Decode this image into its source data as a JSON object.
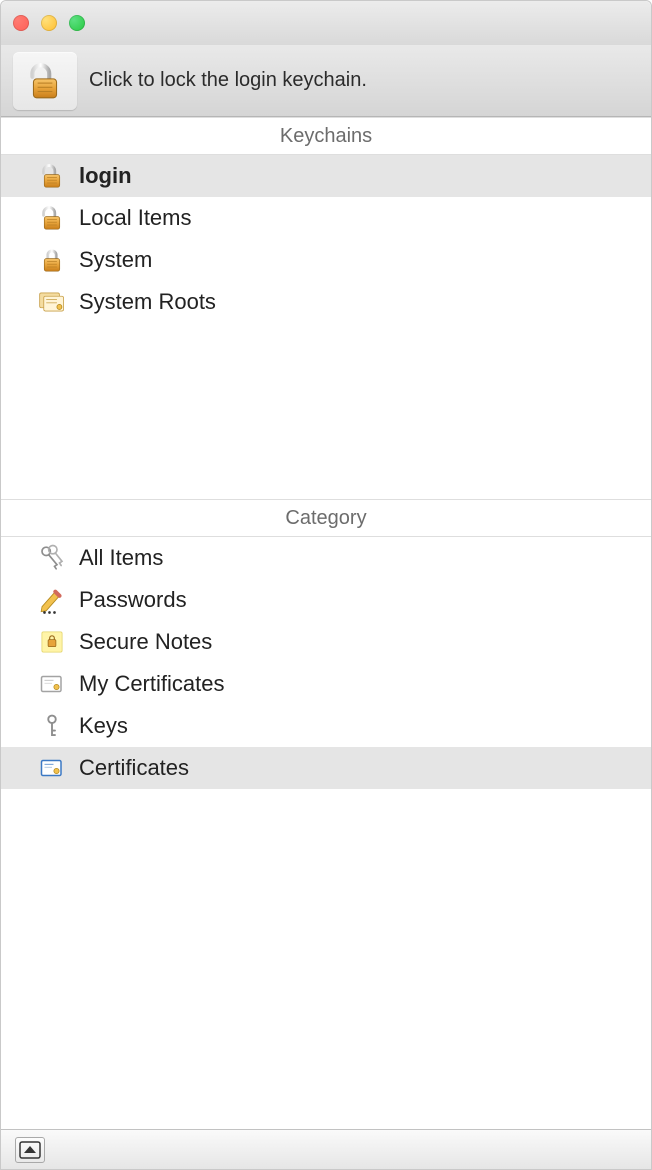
{
  "toolbar": {
    "lock_hint": "Click to lock the login keychain."
  },
  "keychains": {
    "header": "Keychains",
    "items": [
      {
        "label": "login",
        "icon": "padlock-open-icon",
        "selected": true
      },
      {
        "label": "Local Items",
        "icon": "padlock-open-icon",
        "selected": false
      },
      {
        "label": "System",
        "icon": "padlock-closed-icon",
        "selected": false
      },
      {
        "label": "System Roots",
        "icon": "certificate-stack-icon",
        "selected": false
      }
    ]
  },
  "category": {
    "header": "Category",
    "items": [
      {
        "label": "All Items",
        "icon": "keys-icon",
        "selected": false
      },
      {
        "label": "Passwords",
        "icon": "pencil-dots-icon",
        "selected": false
      },
      {
        "label": "Secure Notes",
        "icon": "secure-note-icon",
        "selected": false
      },
      {
        "label": "My Certificates",
        "icon": "certificate-icon",
        "selected": false
      },
      {
        "label": "Keys",
        "icon": "single-key-icon",
        "selected": false
      },
      {
        "label": "Certificates",
        "icon": "certificate-blue-icon",
        "selected": true
      }
    ]
  }
}
